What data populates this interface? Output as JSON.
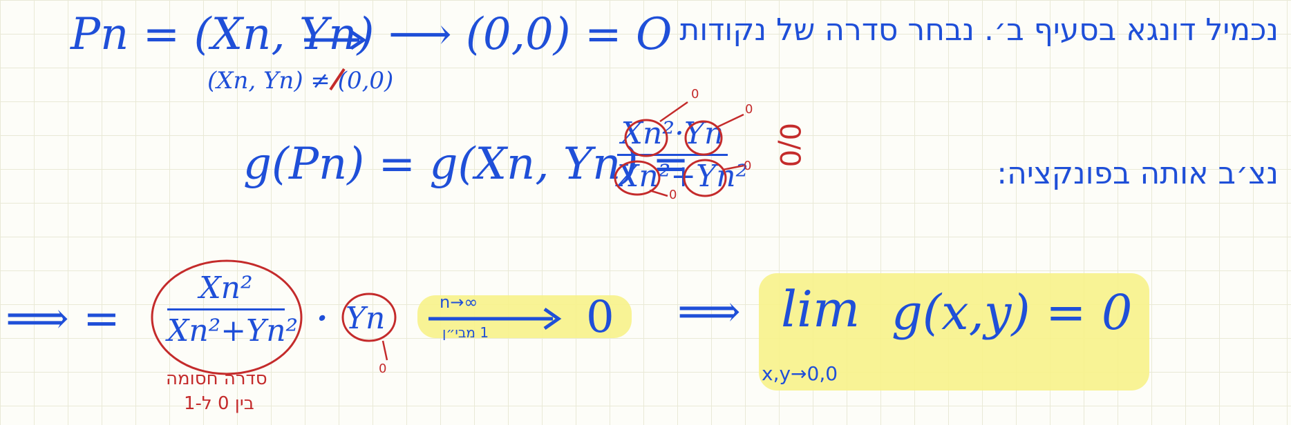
{
  "row1": {
    "heb_intro": "נכמיל דונגא בסעיף ב׳. נבחר סדרה של נקודות",
    "pn_def": "Pn = (Xn, Yn) ⟶ (0,0) = O",
    "pn_cond": "(Xn, Yn) ≠ (0,0)"
  },
  "row2": {
    "heb_subst": "נצ׳ב אותה בפונקציה:",
    "g_expr": "g(Pn) = g(Xn, Yn) =",
    "frac_num": "Xn²·Yn",
    "frac_den": "Xn²+Yn²",
    "zero_over_zero": "0/0",
    "tends_zero": "0"
  },
  "row3": {
    "implies": "⟹ =",
    "frac_num": "Xn²",
    "frac_den": "Xn²+Yn²",
    "dot": "·",
    "yn": "Yn",
    "yn_to": "0",
    "arrow_top": "n→∞",
    "arrow_bottom": "1 מבי״ן",
    "result": "0",
    "bounded_note_1": "סדרה חסומה",
    "bounded_note_2": "בין 0 ל-1",
    "implies2": "⟹",
    "lim": "lim",
    "lim_sub": "x,y→0,0",
    "g_xy": "g(x,y) = 0"
  },
  "colors": {
    "ink_blue": "#1f4fd8",
    "ink_red": "#c42b2b",
    "highlight": "#f7f28a"
  }
}
